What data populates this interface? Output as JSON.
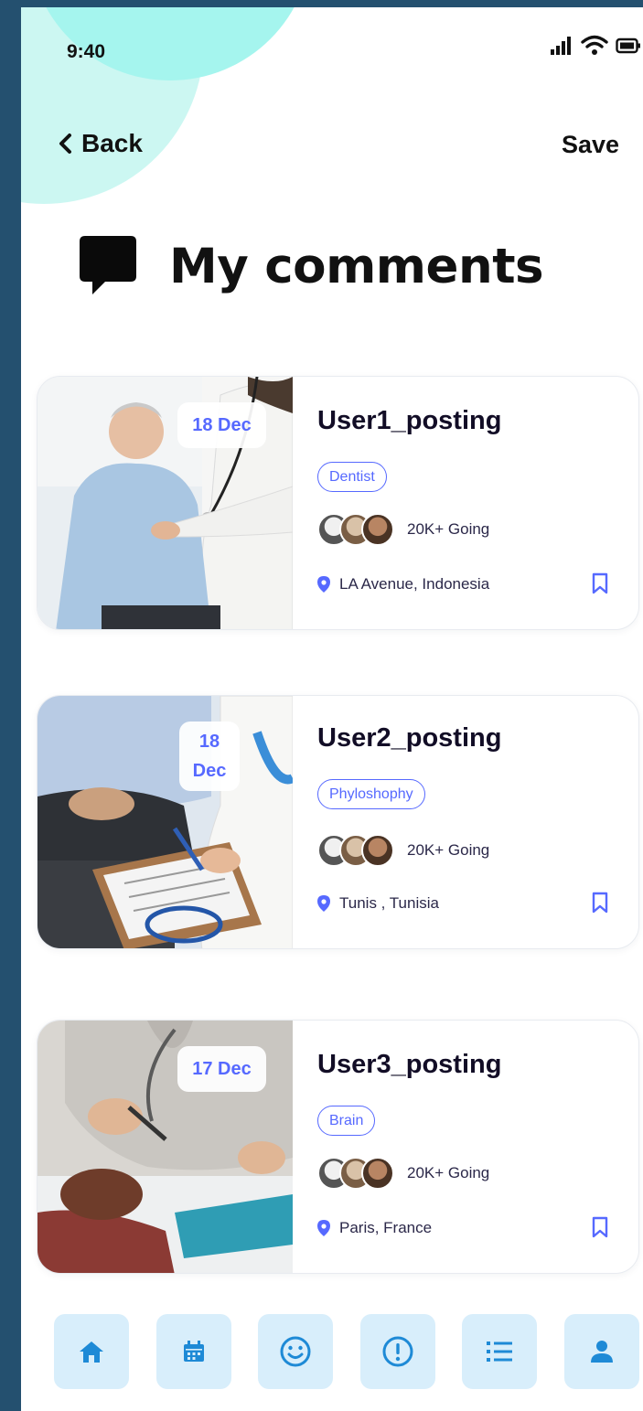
{
  "status_bar": {
    "time": "9:40",
    "icons": [
      "signal-icon",
      "wifi-icon",
      "battery-icon"
    ]
  },
  "header": {
    "back_label": "Back",
    "save_label": "Save"
  },
  "page": {
    "title": "My comments",
    "title_icon": "comment-icon"
  },
  "cards": [
    {
      "title": "User1_posting",
      "date": "18 Dec",
      "tag": "Dentist",
      "going": "20K+ Going",
      "location": "LA Avenue, Indonesia"
    },
    {
      "title": "User2_posting",
      "date_line1": "18",
      "date_line2": "Dec",
      "tag": "Phyloshophy",
      "going": "20K+ Going",
      "location": "Tunis , Tunisia"
    },
    {
      "title": "User3_posting",
      "date": "17 Dec",
      "tag": "Brain",
      "going": "20K+ Going",
      "location": "Paris, France"
    }
  ],
  "bottom_nav": [
    "home-icon",
    "calendar-icon",
    "smiley-icon",
    "alert-icon",
    "list-icon",
    "profile-icon"
  ],
  "colors": {
    "accent": "#5669ff",
    "nav_bg": "#d8eefb",
    "nav_icon": "#1e8ad6",
    "frame": "#24506f",
    "blob": "#a5f5ee"
  }
}
